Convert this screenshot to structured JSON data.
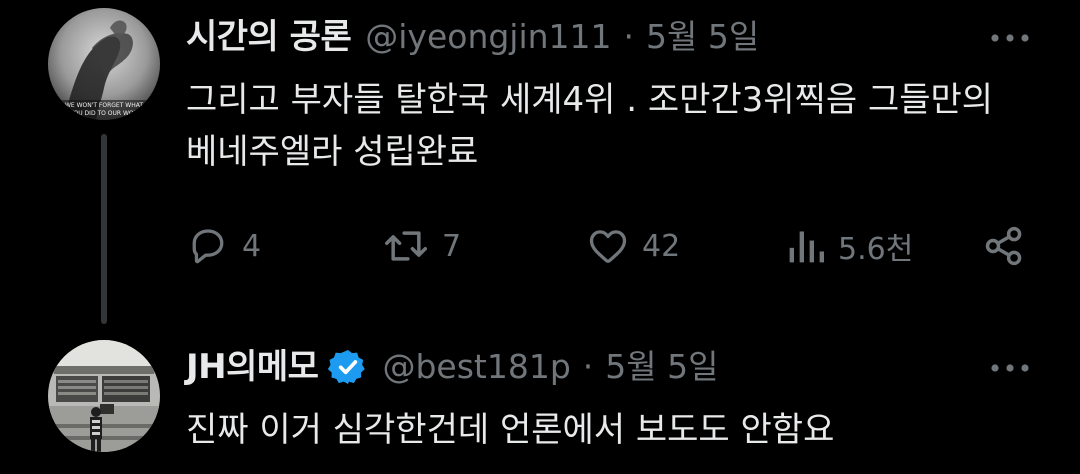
{
  "tweets": [
    {
      "display_name": "시간의 공론",
      "handle": "@iyeongjin111",
      "separator": "·",
      "date": "5월 5일",
      "avatar_caption_1": "WE WON'T FORGET WHAT",
      "avatar_caption_2": "YOU DID TO OUR WOR",
      "text": "그리고 부자들 탈한국 세계4위 . 조만간3위찍음 그들만의 베네주엘라 성립완료",
      "actions": {
        "replies": "4",
        "retweets": "7",
        "likes": "42",
        "views": "5.6천"
      },
      "icons": {
        "more": "more-icon",
        "reply": "reply-icon",
        "retweet": "retweet-icon",
        "like": "heart-icon",
        "views": "views-icon",
        "share": "share-icon"
      }
    },
    {
      "display_name": "JH의메모",
      "handle": "@best181p",
      "separator": "·",
      "date": "5월 5일",
      "verified": true,
      "text": "진짜 이거 심각한건데 언론에서 보도도 안함요",
      "icons": {
        "verified": "verified-badge-icon",
        "more": "more-icon"
      }
    }
  ],
  "colors": {
    "background": "#000000",
    "text": "#e7e9ea",
    "secondary": "#71767b",
    "thread_line": "#333639",
    "verified_blue": "#1d9bf0"
  }
}
